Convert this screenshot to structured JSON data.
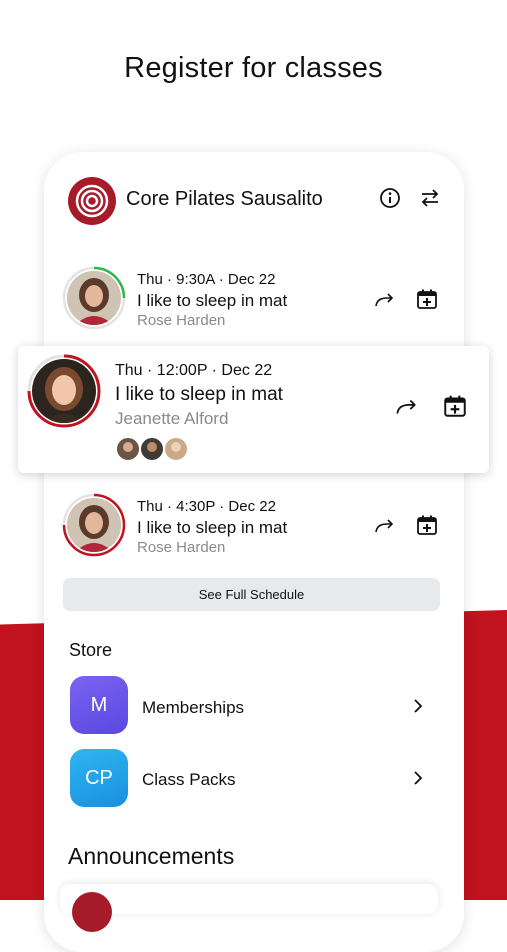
{
  "headline": "Register for classes",
  "studio": {
    "name": "Core Pilates Sausalito"
  },
  "classes": [
    {
      "time": "Thu · 9:30A · Dec 22",
      "title": "I like to sleep in mat",
      "teacher": "Rose Harden"
    },
    {
      "time": "Thu · 12:00P · Dec 22",
      "title": "I like to sleep in mat",
      "teacher": "Jeanette Alford"
    },
    {
      "time": "Thu · 4:30P · Dec 22",
      "title": "I like to sleep in mat",
      "teacher": "Rose Harden"
    }
  ],
  "see_full_schedule": "See Full Schedule",
  "store": {
    "title": "Store",
    "items": [
      {
        "icon_text": "M",
        "label": "Memberships"
      },
      {
        "icon_text": "CP",
        "label": "Class Packs"
      }
    ]
  },
  "announcements": {
    "title": "Announcements"
  },
  "colors": {
    "brand_red": "#c1121f",
    "logo_red": "#a61b2a",
    "progress_green": "#2db84a",
    "memberships_purple": "#6f5bf0",
    "class_packs_blue": "#1fa8ea"
  },
  "icons": [
    "info-icon",
    "swap-icon",
    "share-icon",
    "calendar-add-icon",
    "chevron-right-icon"
  ]
}
